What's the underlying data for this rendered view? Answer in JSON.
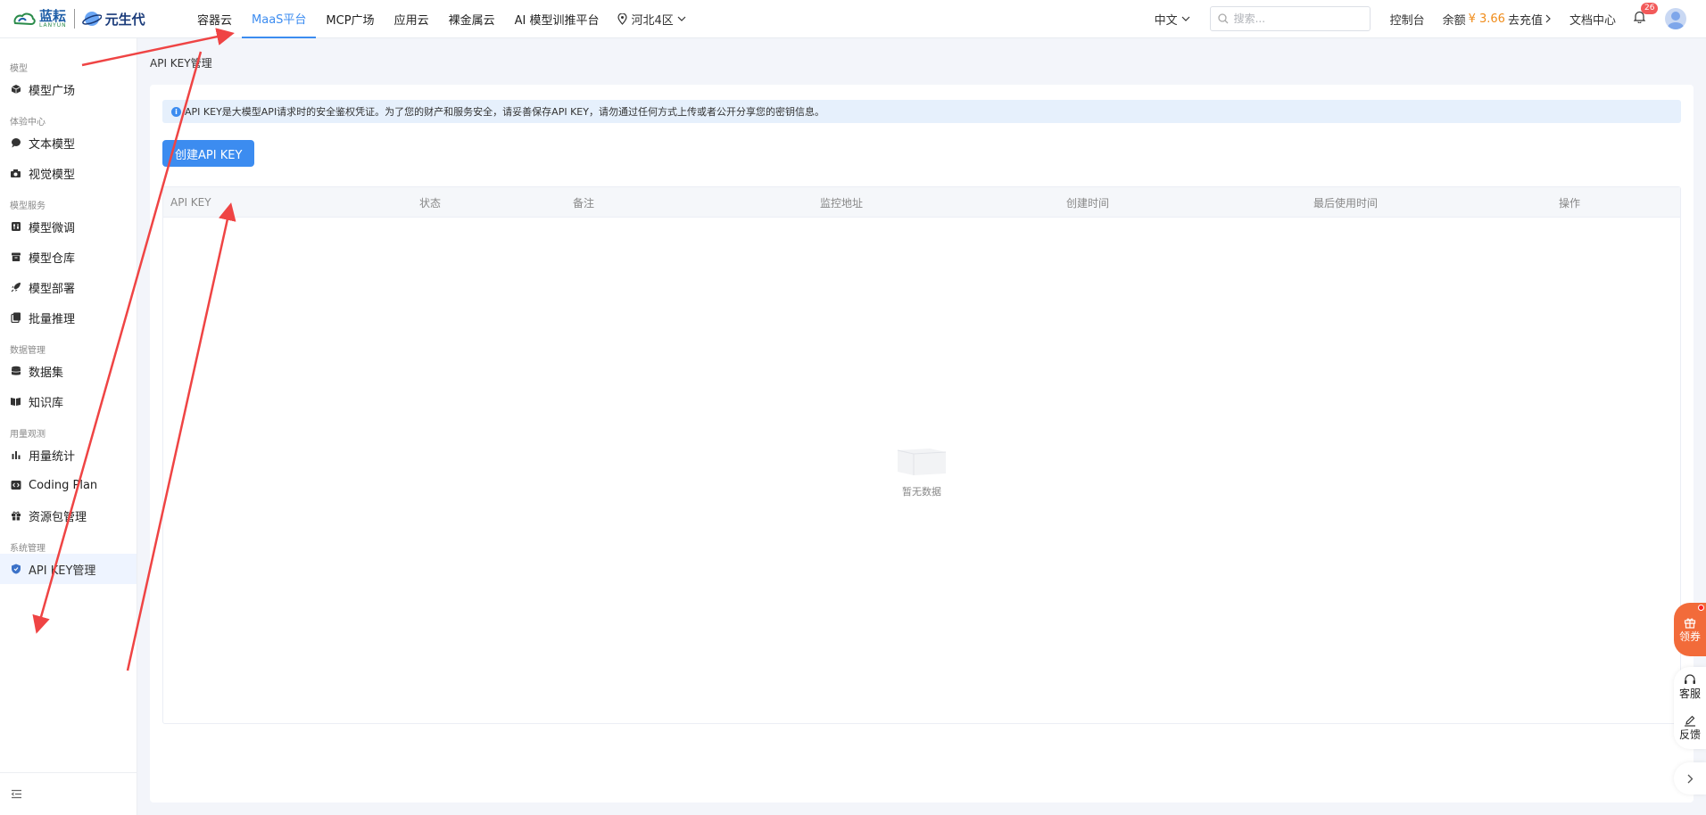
{
  "header": {
    "logo1_text": "蓝耘",
    "logo1_sub": "LANYUN",
    "logo2_text": "元生代",
    "nav": [
      {
        "label": "容器云",
        "active": false
      },
      {
        "label": "MaaS平台",
        "active": true
      },
      {
        "label": "MCP广场",
        "active": false
      },
      {
        "label": "应用云",
        "active": false
      },
      {
        "label": "裸金属云",
        "active": false
      },
      {
        "label": "AI 模型训推平台",
        "active": false
      }
    ],
    "region": "河北4区",
    "language": "中文",
    "search_placeholder": "搜索...",
    "console": "控制台",
    "balance_label": "余额",
    "balance_amount": "¥ 3.66",
    "recharge": "去充值",
    "docs": "文档中心",
    "notification_count": "26"
  },
  "sidebar": {
    "groups": [
      {
        "title": "模型",
        "items": [
          {
            "label": "模型广场",
            "icon": "cube-icon"
          }
        ]
      },
      {
        "title": "体验中心",
        "items": [
          {
            "label": "文本模型",
            "icon": "chat-icon"
          },
          {
            "label": "视觉模型",
            "icon": "camera-icon"
          }
        ]
      },
      {
        "title": "模型服务",
        "items": [
          {
            "label": "模型微调",
            "icon": "sliders-icon"
          },
          {
            "label": "模型仓库",
            "icon": "archive-icon"
          },
          {
            "label": "模型部署",
            "icon": "rocket-icon"
          },
          {
            "label": "批量推理",
            "icon": "layers-icon"
          }
        ]
      },
      {
        "title": "数据管理",
        "items": [
          {
            "label": "数据集",
            "icon": "database-icon"
          },
          {
            "label": "知识库",
            "icon": "book-icon"
          }
        ]
      },
      {
        "title": "用量观测",
        "items": [
          {
            "label": "用量统计",
            "icon": "bar-chart-icon"
          },
          {
            "label": "Coding Plan",
            "icon": "code-icon"
          },
          {
            "label": "资源包管理",
            "icon": "gift-icon"
          }
        ]
      },
      {
        "title": "系统管理",
        "items": [
          {
            "label": "API KEY管理",
            "icon": "shield-icon",
            "active": true
          }
        ]
      }
    ]
  },
  "main": {
    "breadcrumb": "API KEY管理",
    "alert": "API KEY是大模型API请求时的安全鉴权凭证。为了您的财产和服务安全，请妥善保存API KEY，请勿通过任何方式上传或者公开分享您的密钥信息。",
    "create_button": "创建API KEY",
    "columns": [
      "API KEY",
      "状态",
      "备注",
      "监控地址",
      "创建时间",
      "最后使用时间",
      "操作"
    ],
    "empty_text": "暂无数据"
  },
  "widgets": {
    "coupon": "领券",
    "service": "客服",
    "feedback": "反馈"
  },
  "colors": {
    "accent": "#3c8cf0",
    "balance": "#f08c1a",
    "coupon": "#f26b3a",
    "annotation_arrow": "#ef4444"
  }
}
